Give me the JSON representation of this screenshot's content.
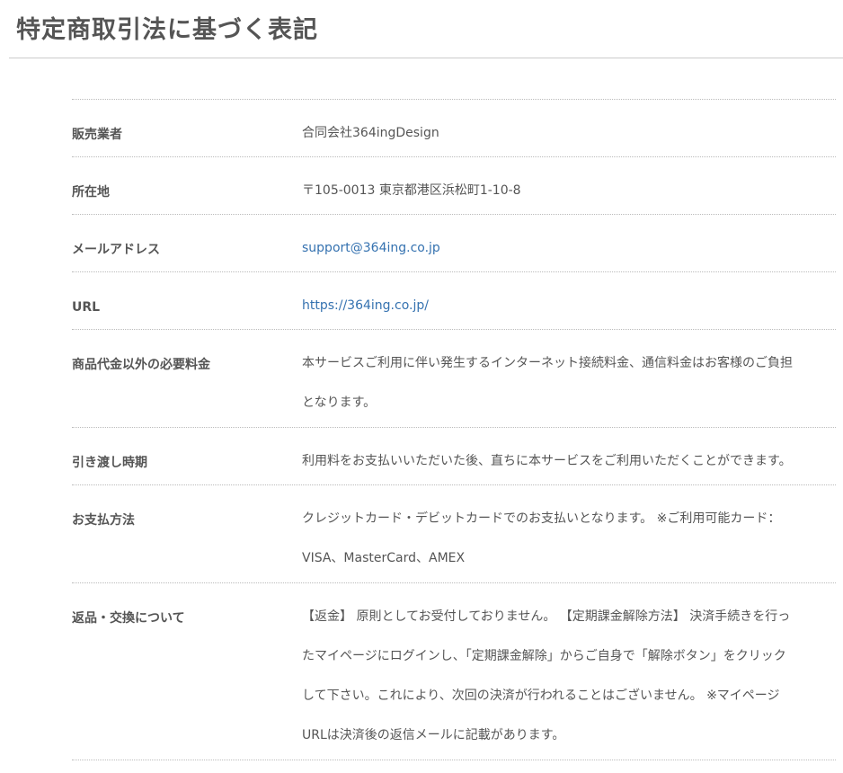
{
  "page": {
    "title": "特定商取引法に基づく表記"
  },
  "rows": [
    {
      "label": "販売業者",
      "value": "合同会社364ingDesign"
    },
    {
      "label": "所在地",
      "value": "〒105-0013 東京都港区浜松町1-10-8"
    },
    {
      "label": "メールアドレス",
      "value": "support@364ing.co.jp"
    },
    {
      "label": "URL",
      "value": "https://364ing.co.jp/"
    },
    {
      "label": "商品代金以外の必要料金",
      "lines": [
        "本サービスご利用に伴い発生するインターネット接続料金、通信料金はお客様のご負担",
        "となります。"
      ]
    },
    {
      "label": "引き渡し時期",
      "value": "利用料をお支払いいただいた後、直ちに本サービスをご利用いただくことができます。"
    },
    {
      "label": "お支払方法",
      "lines": [
        "クレジットカード・デビットカードでのお支払いとなります。 ※ご利用可能カード：",
        "VISA、MasterCard、AMEX"
      ]
    },
    {
      "label": "返品・交換について",
      "lines": [
        "【返金】 原則としてお受付しておりません。 【定期課金解除方法】 決済手続きを行っ",
        "たマイページにログインし、「定期課金解除」からご自身で「解除ボタン」をクリック",
        "して下さい。これにより、次回の決済が行われることはございません。 ※マイページ",
        "URLは決済後の返信メールに記載があります。"
      ]
    }
  ],
  "colors": {
    "text": "#555555",
    "link": "#3572b0",
    "divider": "#bbbbbb"
  }
}
